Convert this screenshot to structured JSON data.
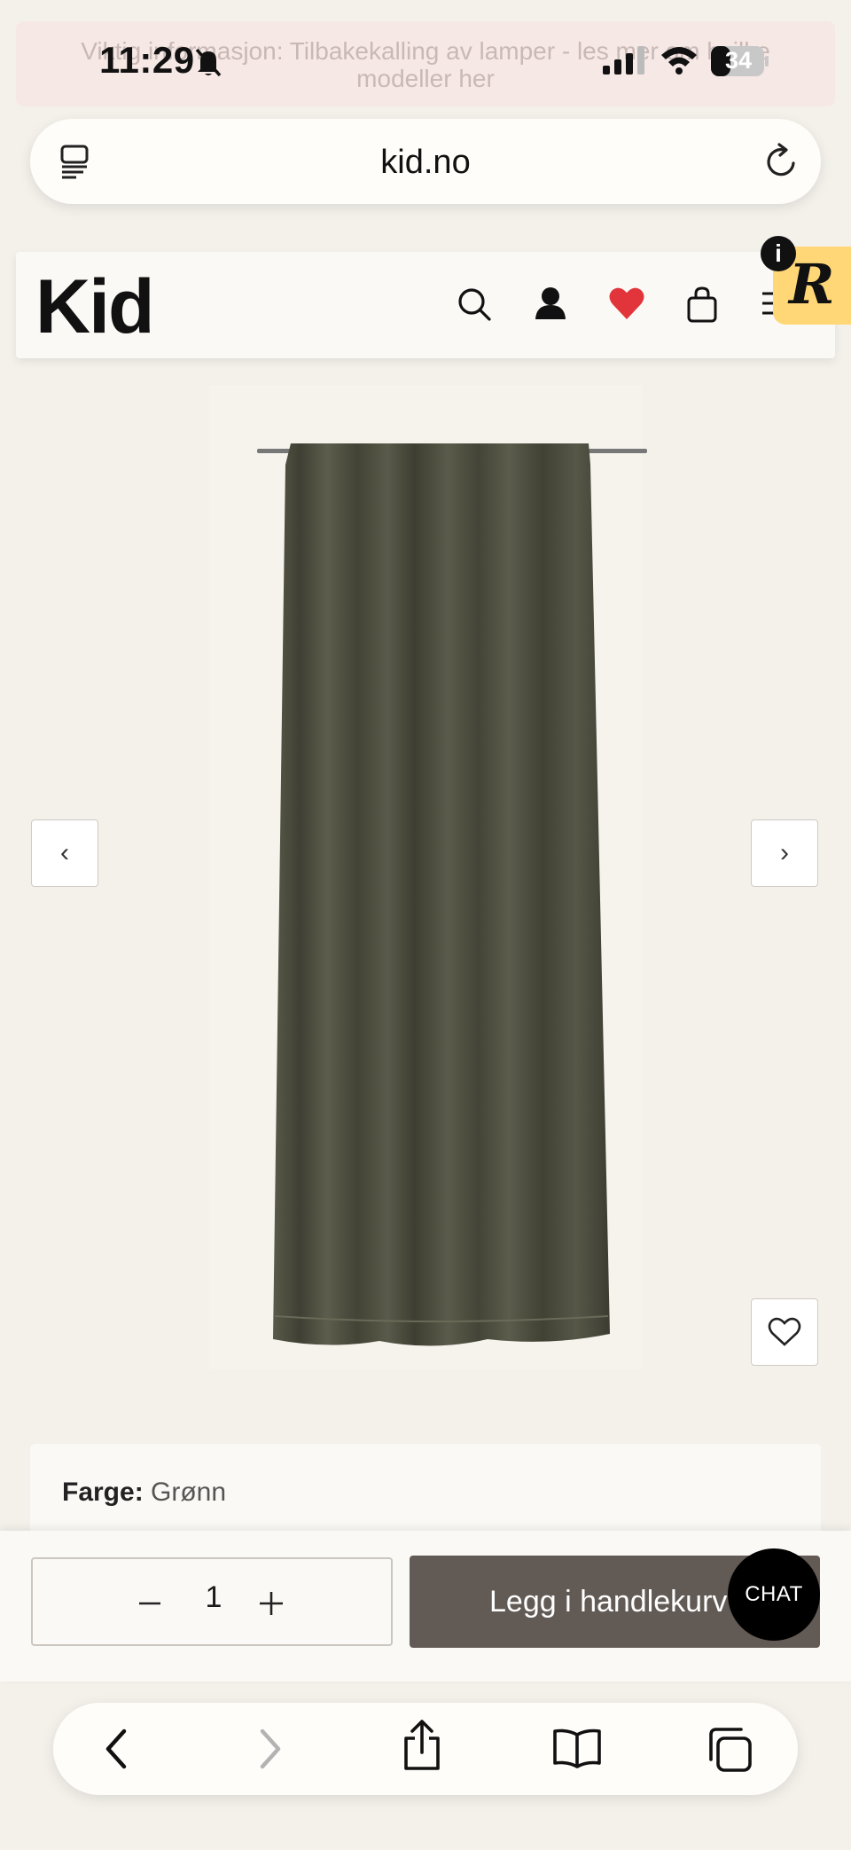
{
  "banner": {
    "text": "Viktig informasjon: Tilbakekalling av lamper - les mer om hvilke modeller her"
  },
  "status_bar": {
    "time": "11:29",
    "battery": "34"
  },
  "browser": {
    "url": "kid.no"
  },
  "site_header": {
    "logo": "Kid",
    "icons": [
      "search-icon",
      "account-icon",
      "heart-icon",
      "bag-icon",
      "menu-icon"
    ],
    "heart_color": "#e2343b",
    "reviews_badge": "R",
    "info_badge": "i"
  },
  "gallery": {
    "prev_label": "‹",
    "next_label": "›"
  },
  "product": {
    "color_label": "Farge:",
    "color_value": "Grønn"
  },
  "purchase": {
    "qty_minus": "−",
    "qty_value": "1",
    "qty_plus": "+",
    "add_to_cart": "Legg i handlekurv",
    "chat_label": "CHAT"
  },
  "colors": {
    "cart_button": "#625a55",
    "curtain": "#4e4e3f",
    "page_bg": "#f4f1eb"
  }
}
